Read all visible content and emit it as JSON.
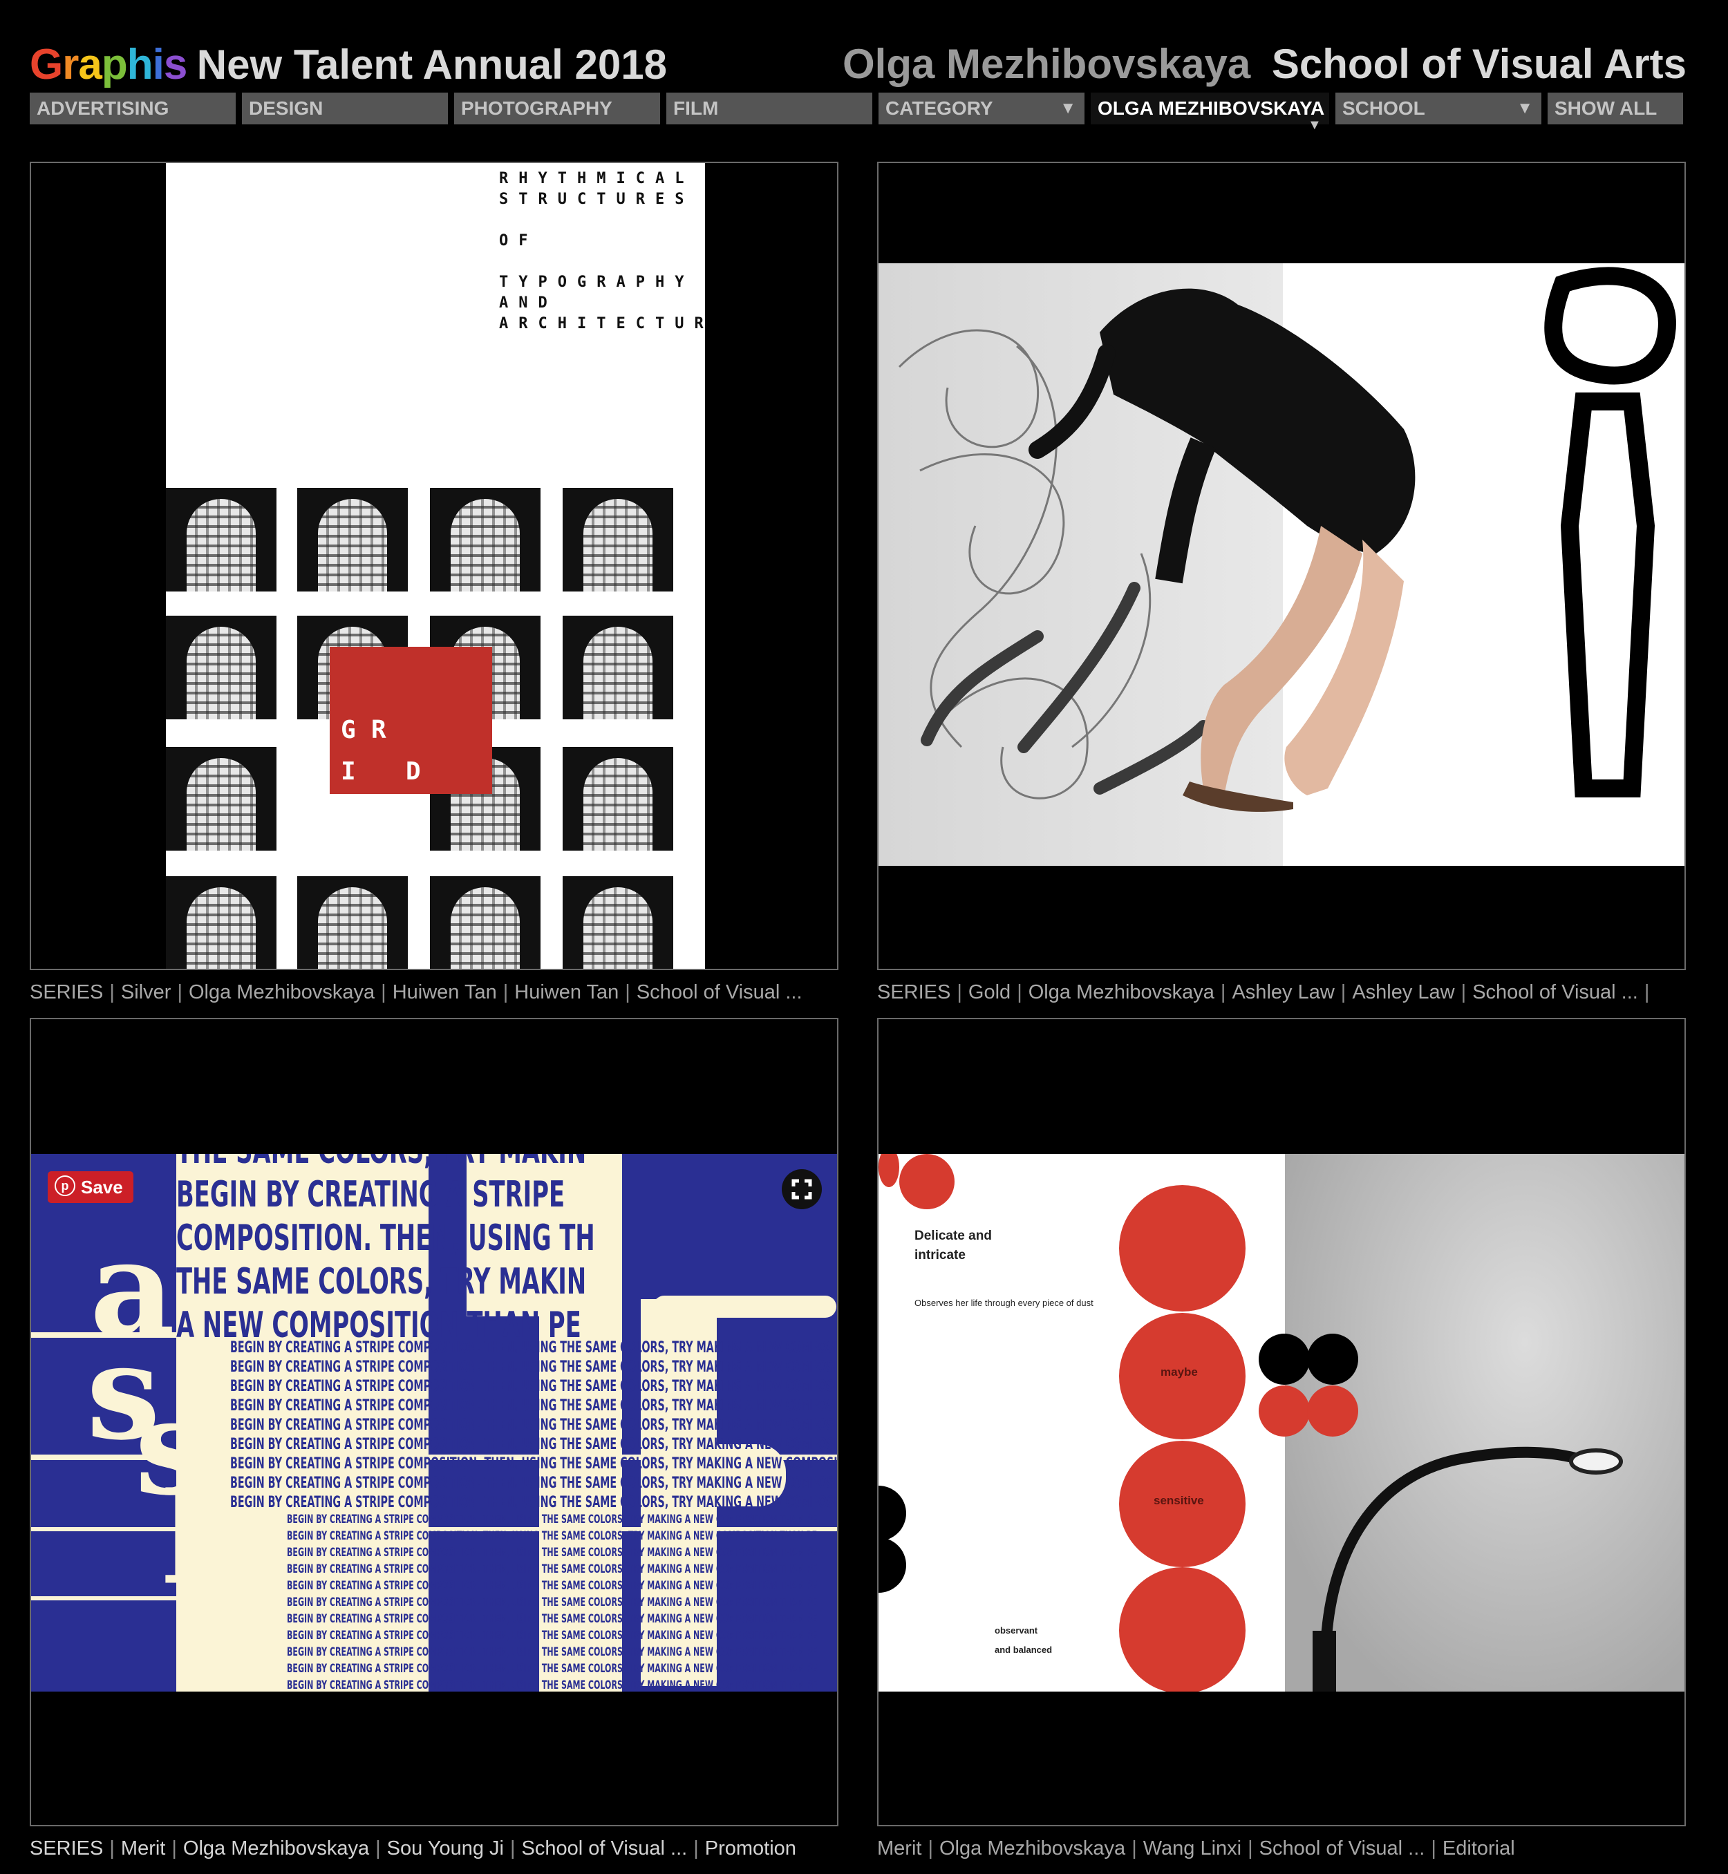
{
  "header": {
    "logo": "Graphis",
    "logo_colors": [
      "#e8432c",
      "#f08a24",
      "#f5c51a",
      "#7cbf3a",
      "#2fb6d8",
      "#3d6fd8",
      "#8c4fd1"
    ],
    "title": "New Talent Annual 2018",
    "artist": "Olga Mezhibovskaya",
    "school": "School of Visual Arts"
  },
  "nav": {
    "items": [
      {
        "label": "ADVERTISING"
      },
      {
        "label": "DESIGN"
      },
      {
        "label": "PHOTOGRAPHY"
      },
      {
        "label": "FILM"
      },
      {
        "label": "CATEGORY",
        "caret": "▼"
      },
      {
        "label": "OLGA MEZHIBOVSKAYA",
        "active": true
      },
      {
        "label": "SCHOOL",
        "caret": "▼"
      },
      {
        "label": "SHOW ALL"
      }
    ],
    "active_marker": "▼"
  },
  "entries": [
    {
      "caption": [
        "SERIES",
        "Silver",
        "Olga Mezhibovskaya",
        "Huiwen Tan",
        "Huiwen Tan",
        "School of Visual ..."
      ],
      "poster": {
        "lines": [
          "RHYTHMICAL",
          "STRUCTURES",
          "",
          "OF",
          "",
          "TYPOGRAPHY",
          "AND",
          "ARCHITECTURE"
        ],
        "grid_letters": [
          "G",
          "R",
          "I",
          "D"
        ],
        "accent": "#c0302a"
      }
    },
    {
      "caption": [
        "SERIES",
        "Gold",
        "Olga Mezhibovskaya",
        "Ashley Law",
        "Ashley Law",
        "School of Visual ...",
        ""
      ]
    },
    {
      "caption": [
        "SERIES",
        "Merit",
        "Olga Mezhibovskaya",
        "Sou Young Ji",
        "School of Visual ...",
        "Promotion"
      ],
      "save_button": "Save",
      "expand_icon": "expand-icon",
      "poster": {
        "big_lines": [
          "THE SAME COLORS, TRY MAKIN",
          "BEGIN BY CREATING A STRIPE",
          "COMPOSITION. THEN, USING TH",
          "THE SAME COLORS, TRY MAKIN",
          "A NEW COMPOSITION THAN PE"
        ],
        "small_line": "BEGIN BY CREATING A STRIPE COMPOSITION. THEN, USING THE SAME COLORS, TRY MAKING A NEW COMPOSITION THAN PE",
        "letters": [
          "a",
          "s",
          "s",
          "p"
        ],
        "background": "#2a2f93",
        "cream": "#fbf4d6"
      }
    },
    {
      "caption": [
        "Merit",
        "Olga Mezhibovskaya",
        "Wang Linxi",
        "School of Visual ...",
        "Editorial"
      ],
      "poster": {
        "heading_1": "Delicate and",
        "heading_2": "intricate",
        "subline": "Observes her life through every piece of dust",
        "circle_words": [
          "maybe",
          "sensitive"
        ],
        "footer_1": "observant",
        "footer_2": "and balanced",
        "accent": "#d63b2f"
      }
    }
  ]
}
